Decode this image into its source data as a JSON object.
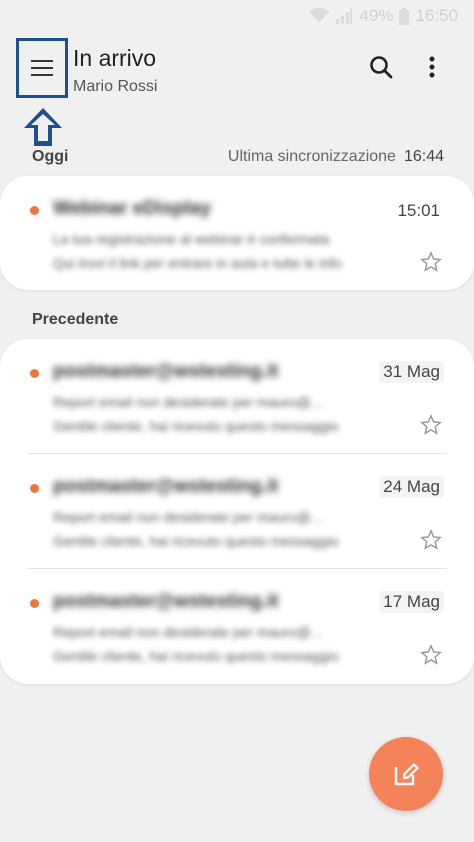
{
  "status_bar": {
    "battery": "49%",
    "time": "16:50"
  },
  "header": {
    "title": "In arrivo",
    "account": "Mario Rossi"
  },
  "sections": {
    "today": {
      "label": "Oggi",
      "sync_label": "Ultima sincronizzazione",
      "sync_time": "16:44"
    },
    "previous": {
      "label": "Precedente"
    }
  },
  "emails": [
    {
      "sender": "Webinar eDisplay",
      "preview_1": "La tua registrazione al webinar è confermata",
      "preview_2": "Qui trovi il link per entrare in aula e tutte le info",
      "date": "15:01"
    },
    {
      "sender": "postmaster@wstesting.it",
      "preview_1": "Report email non desiderate per mauro@...",
      "preview_2": "Gentile cliente, hai ricevuto questo messaggio",
      "date": "31 Mag"
    },
    {
      "sender": "postmaster@wstesting.it",
      "preview_1": "Report email non desiderate per mauro@...",
      "preview_2": "Gentile cliente, hai ricevuto questo messaggio",
      "date": "24 Mag"
    },
    {
      "sender": "postmaster@wstesting.it",
      "preview_1": "Report email non desiderate per mauro@...",
      "preview_2": "Gentile cliente, hai ricevuto questo messaggio",
      "date": "17 Mag"
    }
  ],
  "colors": {
    "accent": "#f0743e",
    "fab": "#f4835a",
    "highlight": "#1e4f8f"
  },
  "icons": {
    "menu": "hamburger-menu-icon",
    "search": "search-icon",
    "more": "more-vertical-icon",
    "compose": "compose-icon",
    "star": "star-outline-icon"
  }
}
